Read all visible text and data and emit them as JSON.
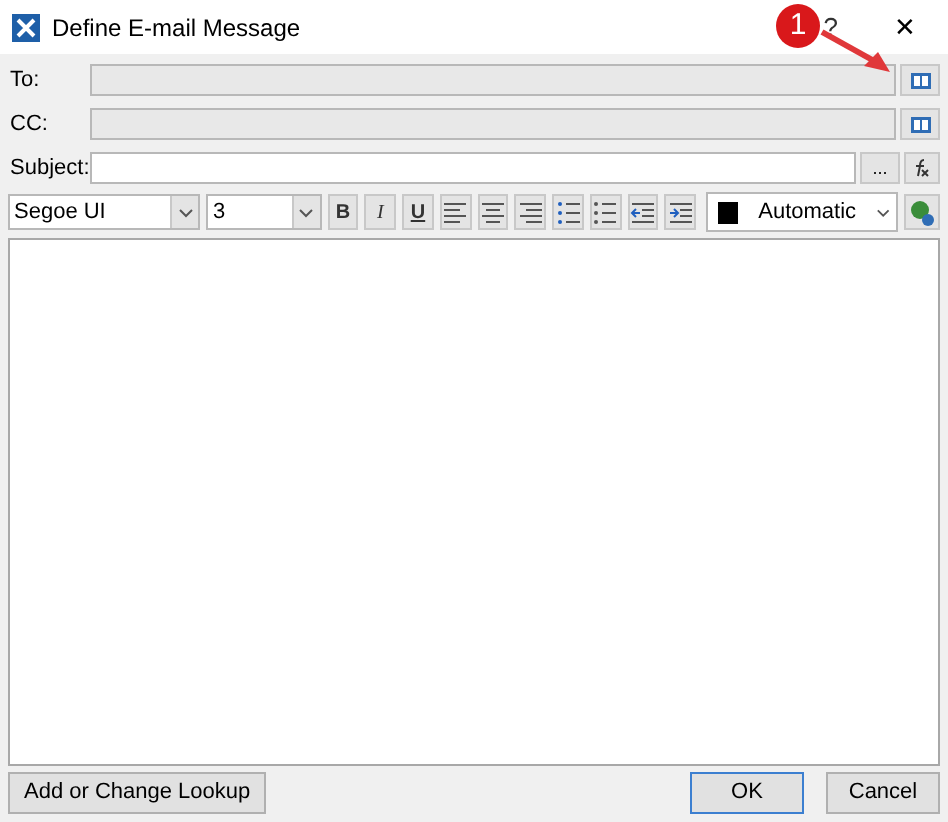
{
  "window": {
    "title": "Define E-mail Message",
    "help": "?",
    "close": "✕"
  },
  "fields": [
    {
      "label": "To:",
      "kind": "address",
      "disabled": true
    },
    {
      "label": "CC:",
      "kind": "address",
      "disabled": true
    },
    {
      "label": "Subject:",
      "kind": "subject",
      "disabled": false,
      "more": "..."
    }
  ],
  "toolbar": {
    "font": "Segoe UI",
    "size": "3",
    "color_label": "Automatic",
    "color": "#000000",
    "format_buttons": [
      {
        "kind": "bold",
        "label": "B"
      },
      {
        "kind": "italic",
        "label": "I"
      },
      {
        "kind": "underline",
        "label": "U"
      },
      {
        "kind": "align-left"
      },
      {
        "kind": "align-center"
      },
      {
        "kind": "align-right"
      },
      {
        "kind": "numbered-list"
      },
      {
        "kind": "bullet-list"
      },
      {
        "kind": "outdent"
      },
      {
        "kind": "indent"
      }
    ]
  },
  "callout": {
    "label": "1"
  },
  "buttons": {
    "lookup": "Add or Change Lookup",
    "ok": "OK",
    "cancel": "Cancel"
  }
}
